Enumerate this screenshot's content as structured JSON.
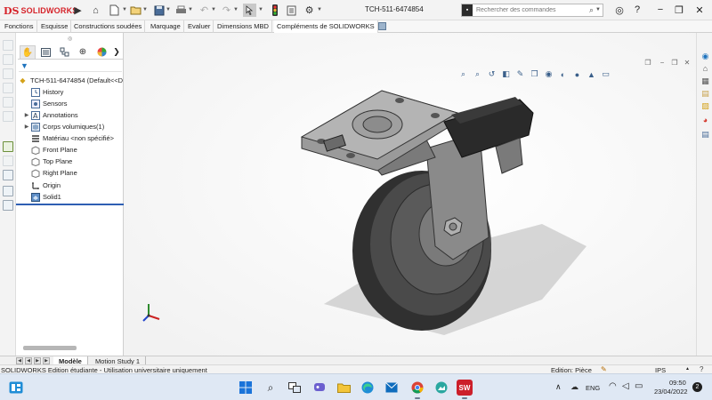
{
  "app": {
    "brand_ds": "DS",
    "brand_name": "SOLIDWORKS",
    "document_title": "TCH-511-6474854"
  },
  "command_search": {
    "placeholder": "Rechercher des commandes"
  },
  "command_manager_tabs": [
    {
      "label": "Fonctions"
    },
    {
      "label": "Esquisse"
    },
    {
      "label": "Constructions soudées"
    },
    {
      "label": "Marquage"
    },
    {
      "label": "Evaluer"
    },
    {
      "label": "Dimensions MBD"
    },
    {
      "label": "Compléments de SOLIDWORKS"
    }
  ],
  "feature_tree": {
    "root": "TCH-511-6474854  (Default<<D",
    "items": [
      {
        "label": "History",
        "icon": "history-folder-icon"
      },
      {
        "label": "Sensors",
        "icon": "sensors-icon"
      },
      {
        "label": "Annotations",
        "icon": "annotations-icon"
      },
      {
        "label": "Corps volumiques(1)",
        "icon": "solid-bodies-icon"
      },
      {
        "label": "Matériau <non spécifié>",
        "icon": "material-icon"
      },
      {
        "label": "Front Plane",
        "icon": "plane-icon"
      },
      {
        "label": "Top Plane",
        "icon": "plane-icon"
      },
      {
        "label": "Right Plane",
        "icon": "plane-icon"
      },
      {
        "label": "Origin",
        "icon": "origin-icon"
      },
      {
        "label": "Solid1",
        "icon": "solid-feature-icon"
      }
    ]
  },
  "bottom_tabs": [
    {
      "label": "Modèle",
      "active": true
    },
    {
      "label": "Motion Study 1",
      "active": false
    }
  ],
  "status_bar": {
    "left": "SOLIDWORKS Edition étudiante - Utilisation universitaire uniquement",
    "edit_mode": "Edition: Pièce",
    "units": "IPS"
  },
  "taskbar": {
    "language": "ENG",
    "time": "09:50",
    "date": "23/04/2022",
    "notifications": "2"
  },
  "colors": {
    "brand_red": "#d6232a",
    "accent_blue": "#2e5fb3",
    "taskbar_bg": "#dfe8f4"
  }
}
